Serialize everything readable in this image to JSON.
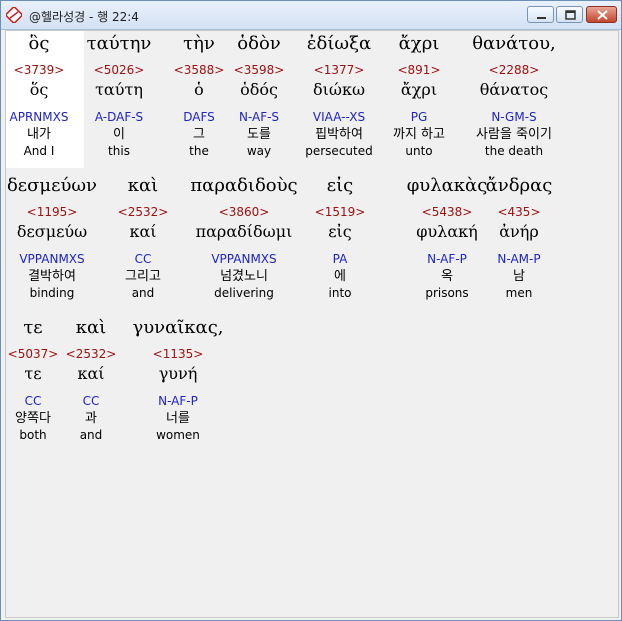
{
  "window": {
    "title": "@헬라성경 - 행 22:4"
  },
  "rows": [
    [
      {
        "greek": "ὃς",
        "strong": "<3739>",
        "lemma": "ὅς",
        "parse": "APRNMXS",
        "korean": "내가",
        "english": "And I"
      },
      {
        "greek": "ταύτην",
        "strong": "<5026>",
        "lemma": "ταύτη",
        "parse": "A-DAF-S",
        "korean": "이",
        "english": "this"
      },
      {
        "greek": "τὴν",
        "strong": "<3588>",
        "lemma": "ὁ",
        "parse": "DAFS",
        "korean": "그",
        "english": "the"
      },
      {
        "greek": "ὁδὸν",
        "strong": "<3598>",
        "lemma": "ὁδός",
        "parse": "N-AF-S",
        "korean": "도를",
        "english": "way"
      },
      {
        "greek": "ἐδίωξα",
        "strong": "<1377>",
        "lemma": "διώκω",
        "parse": "VIAA--XS",
        "korean": "핍박하여",
        "english": "persecuted"
      },
      {
        "greek": "ἄχρι",
        "strong": "<891>",
        "lemma": "ἄχρι",
        "parse": "PG",
        "korean": "까지 하고",
        "english": "unto"
      },
      {
        "greek": "θανάτου,",
        "strong": "<2288>",
        "lemma": "θάνατος",
        "parse": "N-GM-S",
        "korean": "사람을 죽이기",
        "english": "the death"
      }
    ],
    [
      {
        "greek": "δεσμεύων",
        "strong": "<1195>",
        "lemma": "δεσμεύω",
        "parse": "VPPANMXS",
        "korean": "결박하여",
        "english": "binding"
      },
      {
        "greek": "καὶ",
        "strong": "<2532>",
        "lemma": "καί",
        "parse": "CC",
        "korean": "그리고",
        "english": "and"
      },
      {
        "greek": "παραδιδοὺς",
        "strong": "<3860>",
        "lemma": "παραδίδωμι",
        "parse": "VPPANMXS",
        "korean": "넘겼노니",
        "english": "delivering"
      },
      {
        "greek": "εἰς",
        "strong": "<1519>",
        "lemma": "εἰς",
        "parse": "PA",
        "korean": "에",
        "english": "into"
      },
      {
        "greek": "φυλακὰς",
        "strong": "<5438>",
        "lemma": "φυλακή",
        "parse": "N-AF-P",
        "korean": "옥",
        "english": "prisons"
      },
      {
        "greek": "ἄνδρας",
        "strong": "<435>",
        "lemma": "ἀνήρ",
        "parse": "N-AM-P",
        "korean": "남",
        "english": "men"
      }
    ],
    [
      {
        "greek": "τε",
        "strong": "<5037>",
        "lemma": "τε",
        "parse": "CC",
        "korean": "양쪽다",
        "english": "both"
      },
      {
        "greek": "καὶ",
        "strong": "<2532>",
        "lemma": "καί",
        "parse": "CC",
        "korean": "과",
        "english": "and"
      },
      {
        "greek": "γυναῖκας,",
        "strong": "<1135>",
        "lemma": "γυνή",
        "parse": "N-AF-P",
        "korean": "너를",
        "english": "women"
      }
    ]
  ]
}
